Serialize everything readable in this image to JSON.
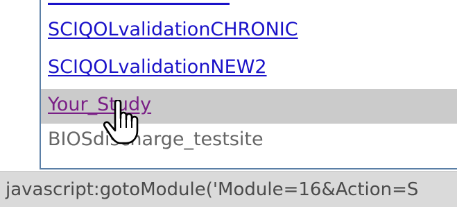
{
  "links": [
    {
      "label": "SCIQOLvalidationCHRONIC",
      "state": "link"
    },
    {
      "label": "SCIQOLvalidationNEW2",
      "state": "link"
    },
    {
      "label": "Your_Study",
      "state": "visited-hover"
    },
    {
      "label": "BIOSdischarge_testsite",
      "state": "disabled"
    }
  ],
  "status_bar": {
    "url": "javascript:gotoModule('Module=16&Action=S"
  },
  "cursor": {
    "icon": "hand-pointer-icon"
  },
  "colors": {
    "link": "#1a12c9",
    "visited": "#7a1f86",
    "disabled": "#666666",
    "hover_row": "#cbcbcb",
    "border": "#5b7fa6",
    "status_bg": "#dadada"
  }
}
